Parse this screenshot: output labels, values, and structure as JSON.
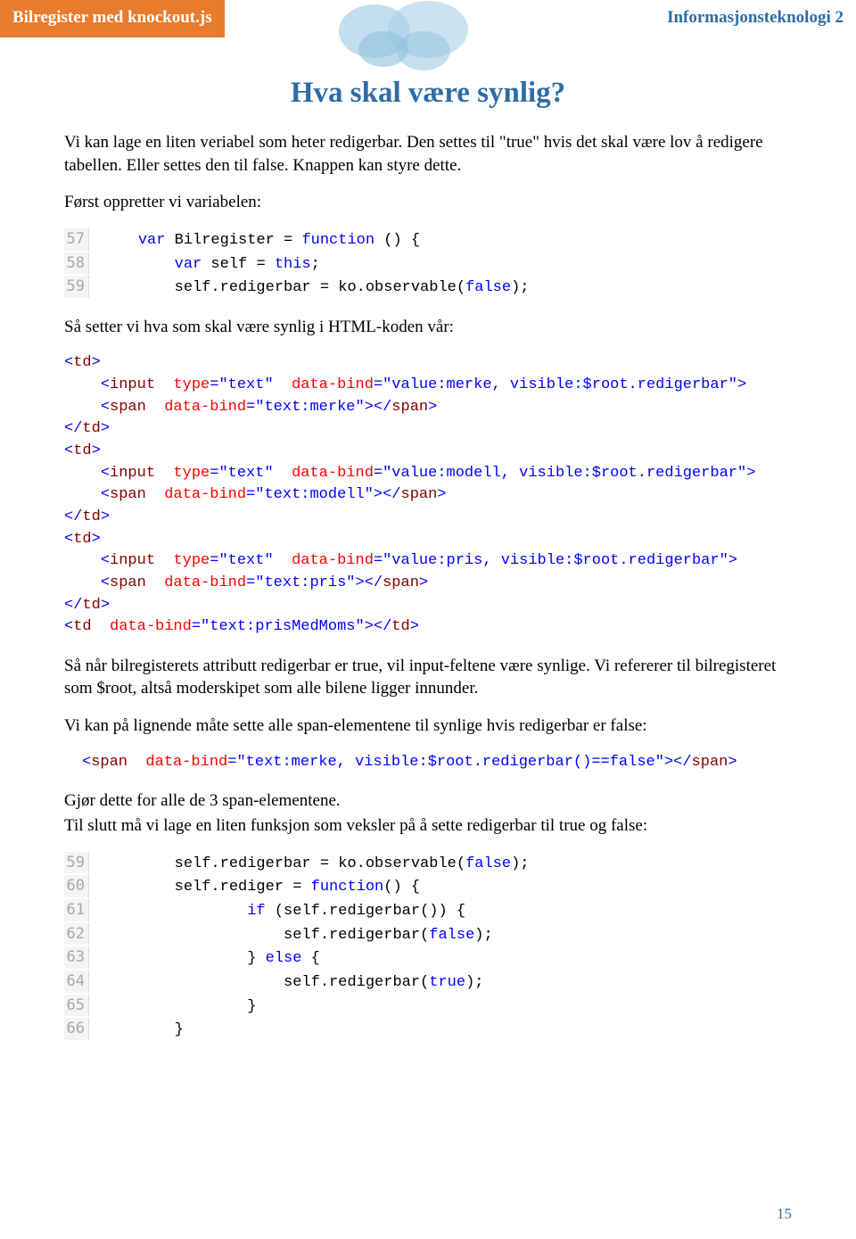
{
  "header": {
    "left": "Bilregister med knockout.js",
    "right": "Informasjonsteknologi 2"
  },
  "title": "Hva skal være synlig?",
  "p1": "Vi kan lage en liten veriabel som heter redigerbar. Den settes til \"true\" hvis det skal være lov å redigere tabellen. Eller settes den til false. Knappen kan styre dette.",
  "p2": "Først oppretter vi variabelen:",
  "code1": {
    "lines": [
      {
        "n": "57",
        "t": "var Bilregister = function () {"
      },
      {
        "n": "58",
        "t": "    var self = this;"
      },
      {
        "n": "59",
        "t": "    self.redigerbar = ko.observable(false);"
      }
    ]
  },
  "p3": "Så setter vi hva som skal være synlig i HTML-koden vår:",
  "code2": {
    "raw": "<td>\n    <input type=\"text\" data-bind=\"value:merke, visible:$root.redigerbar\">\n    <span data-bind=\"text:merke\"></span>\n</td>\n<td>\n    <input type=\"text\" data-bind=\"value:modell, visible:$root.redigerbar\">\n    <span data-bind=\"text:modell\"></span>\n</td>\n<td>\n    <input type=\"text\" data-bind=\"value:pris, visible:$root.redigerbar\">\n    <span data-bind=\"text:pris\"></span>\n</td>\n<td data-bind=\"text:prisMedMoms\"></td>"
  },
  "p4": "Så når bilregisterets attributt redigerbar er true, vil input-feltene være synlige. Vi refererer til bilregisteret som $root, altså moderskipet som alle bilene ligger innunder.",
  "p5": "Vi kan på lignende måte sette alle span-elementene til synlige hvis redigerbar er false:",
  "code3": {
    "raw": "<span data-bind=\"text:merke, visible:$root.redigerbar()==false\"></span>"
  },
  "p6": "Gjør dette for alle de 3 span-elementene.",
  "p7": "Til slutt må vi lage en liten funksjon som veksler på å sette redigerbar til true og false:",
  "code4": {
    "lines": [
      {
        "n": "59",
        "t": "self.redigerbar = ko.observable(false);"
      },
      {
        "n": "60",
        "t": "self.rediger = function() {"
      },
      {
        "n": "61",
        "t": "        if (self.redigerbar()) {"
      },
      {
        "n": "62",
        "t": "            self.redigerbar(false);"
      },
      {
        "n": "63",
        "t": "        } else {"
      },
      {
        "n": "64",
        "t": "            self.redigerbar(true);"
      },
      {
        "n": "65",
        "t": "        }"
      },
      {
        "n": "66",
        "t": "}"
      }
    ]
  },
  "page_number": "15"
}
